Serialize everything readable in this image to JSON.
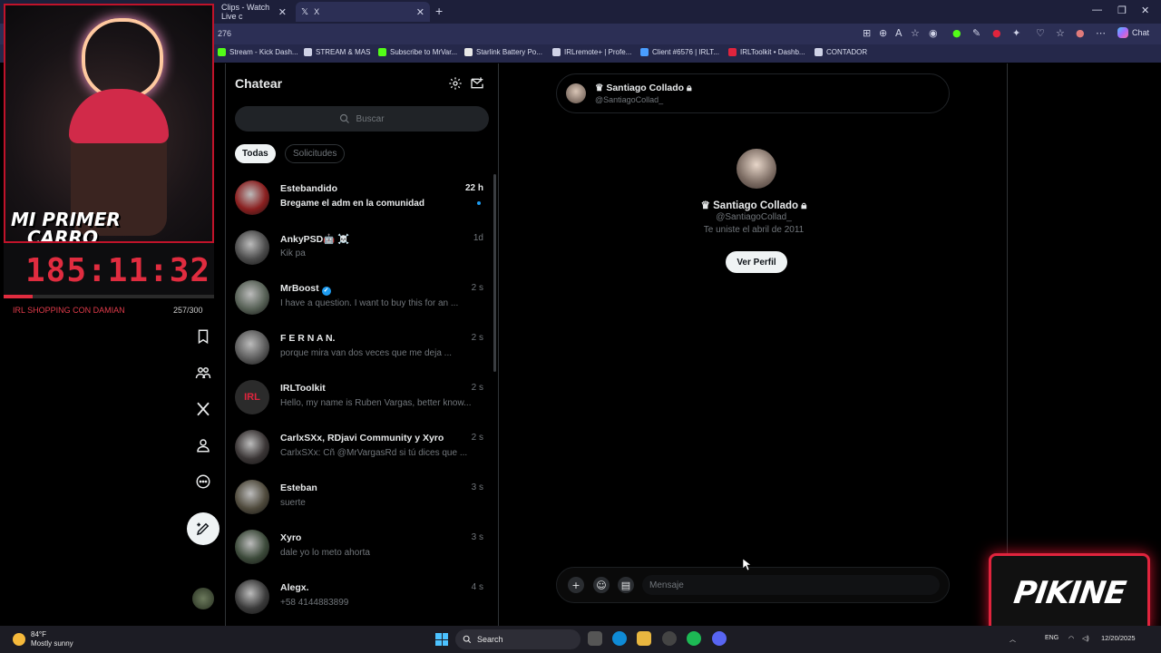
{
  "browser": {
    "tabs": [
      {
        "label": "Clips - Watch Live c"
      },
      {
        "label": "X"
      }
    ],
    "address_fragment": "276",
    "chat_label": "Chat",
    "bookmarks": [
      {
        "label": "Stream - Kick Dash...",
        "color": "#53fc18"
      },
      {
        "label": "STREAM & MAS",
        "color": "#cfd2e6"
      },
      {
        "label": "Subscribe to MrVar...",
        "color": "#53fc18"
      },
      {
        "label": "Starlink Battery Po...",
        "color": "#e8e8e8"
      },
      {
        "label": "IRLremote+ | Profe...",
        "color": "#cfd2e6"
      },
      {
        "label": "Client #6576 | IRLT...",
        "color": "#4a9eff"
      },
      {
        "label": "IRLToolkit • Dashb...",
        "color": "#e0243d"
      },
      {
        "label": "CONTADOR",
        "color": "#cfd2e6"
      }
    ]
  },
  "stream": {
    "banner_line1": "MI PRIMER",
    "banner_line2": "CARRO",
    "timer": "185:11:32",
    "goal_label": "IRL SHOPPING CON DAMIAN",
    "goal_count": "257/300",
    "goal_progress": 0.14,
    "accent": "#e02c3f"
  },
  "nav": {
    "icons": [
      "bookmark-icon",
      "communities-icon",
      "x-logo-icon",
      "profile-icon",
      "more-icon"
    ],
    "compose": "compose-post-icon"
  },
  "chat_list": {
    "title": "Chatear",
    "search_placeholder": "Buscar",
    "filters": [
      {
        "label": "Todas",
        "active": true
      },
      {
        "label": "Solicitudes",
        "active": false
      }
    ],
    "conversations": [
      {
        "name": "Estebandido",
        "message": "Bregame el adm en la comunidad",
        "time": "22 h",
        "unread": true,
        "avatar": "#8a1f1f"
      },
      {
        "name": "AnkyPSD🤖 ☠️",
        "message": "Kik pa",
        "time": "1d",
        "unread": false,
        "avatar": "#4a4a4a"
      },
      {
        "name": "MrBoost",
        "message": "I have a question. I want to buy this for an ...",
        "time": "2 s",
        "unread": false,
        "verified": true,
        "avatar": "#566055"
      },
      {
        "name": "F E R N A N.",
        "message": "porque mira van dos veces que me deja ...",
        "time": "2 s",
        "unread": false,
        "avatar": "#5a5a5a"
      },
      {
        "name": "IRLToolkit",
        "message": "Hello, my name is Ruben Vargas, better know...",
        "time": "2 s",
        "unread": false,
        "avatar": "#2b2b2b",
        "avatar_text": "IRL"
      },
      {
        "name": "CarlxSXx, RDjavi Community y Xyro",
        "message": "CarlxSXx: Cñ @MrVargasRd  si tú dices que ...",
        "time": "2 s",
        "unread": false,
        "avatar": "#3a3535"
      },
      {
        "name": "Esteban",
        "message": "suerte",
        "time": "3 s",
        "unread": false,
        "avatar": "#4f4a3c"
      },
      {
        "name": "Xyro",
        "message": "dale yo lo meto ahorta",
        "time": "3 s",
        "unread": false,
        "avatar": "#3c4a3a"
      },
      {
        "name": "Alegx.",
        "message": "+58 4144883899",
        "time": "4 s",
        "unread": false,
        "avatar": "#3a3a3a"
      }
    ]
  },
  "conversation": {
    "name": "Santiago Collado",
    "handle": "@SantiagoCollad_",
    "joined": "Te uniste el abril de 2011",
    "profile_button": "Ver Perfil",
    "composer_placeholder": "Mensaje"
  },
  "overlay_logo": "PIKINE",
  "taskbar": {
    "temperature": "84°F",
    "weather": "Mostly sunny",
    "search_label": "Search",
    "language": "ENG",
    "date": "12/20/2025"
  }
}
